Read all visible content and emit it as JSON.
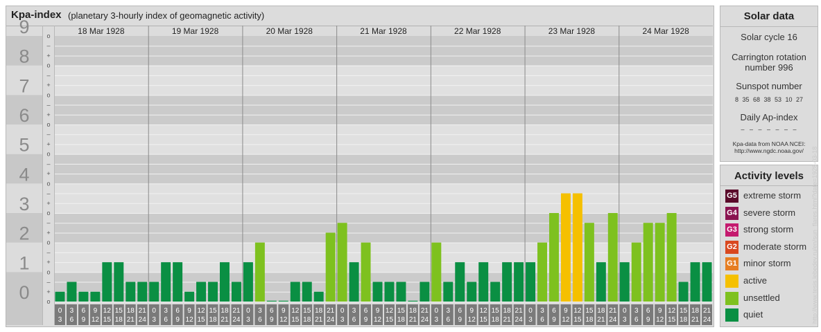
{
  "header": {
    "title": "Kpa-index",
    "subtitle": "(planetary 3-hourly index of geomagnetic activity)"
  },
  "chart_data": {
    "type": "bar",
    "title": "Kpa-index",
    "subtitle": "(planetary 3-hourly index of geomagnetic activity)",
    "ylim": [
      0,
      9
    ],
    "y_ticks": [
      "0",
      "1",
      "2",
      "3",
      "4",
      "5",
      "6",
      "7",
      "8",
      "9"
    ],
    "minor_tick_labels": [
      "+",
      "–",
      "o"
    ],
    "days": [
      "18 Mar 1928",
      "19 Mar 1928",
      "20 Mar 1928",
      "21 Mar 1928",
      "22 Mar 1928",
      "23 Mar 1928",
      "24 Mar 1928"
    ],
    "interval_labels": [
      [
        "0",
        "3"
      ],
      [
        "3",
        "6"
      ],
      [
        "6",
        "9"
      ],
      [
        "9",
        "12"
      ],
      [
        "12",
        "15"
      ],
      [
        "15",
        "18"
      ],
      [
        "18",
        "21"
      ],
      [
        "21",
        "24"
      ]
    ],
    "values": [
      [
        0.333,
        0.667,
        0.333,
        0.333,
        1.333,
        1.333,
        0.667,
        0.667
      ],
      [
        0.667,
        1.333,
        1.333,
        0.333,
        0.667,
        0.667,
        1.333,
        0.667
      ],
      [
        1.333,
        2.0,
        0.0,
        0.0,
        0.667,
        0.667,
        0.333,
        2.333
      ],
      [
        2.667,
        1.333,
        2.0,
        0.667,
        0.667,
        0.667,
        0.0,
        0.667
      ],
      [
        2.0,
        0.667,
        1.333,
        0.667,
        1.333,
        0.667,
        1.333,
        1.333
      ],
      [
        1.333,
        2.0,
        3.0,
        3.667,
        3.667,
        2.667,
        1.333,
        3.0
      ],
      [
        1.333,
        2.0,
        2.667,
        2.667,
        3.0,
        0.667,
        1.333,
        1.333
      ]
    ],
    "grid": true
  },
  "solar": {
    "title": "Solar data",
    "cycle": "Solar cycle 16",
    "carrington_line1": "Carrington rotation",
    "carrington_line2": "number 996",
    "sunspot_title": "Sunspot number",
    "sunspot_values": "8 35 68 38 53 10 27",
    "ap_title": "Daily Ap-index",
    "ap_values": "– – – – – – –",
    "source_line1": "Kpa-data from NOAA NCEI:",
    "source_line2": "http://www.ngdc.noaa.gov/"
  },
  "legend": {
    "title": "Activity levels",
    "items": [
      {
        "code": "G5",
        "label": "extreme storm",
        "color": "#5a0a2a"
      },
      {
        "code": "G4",
        "label": "severe storm",
        "color": "#8a1450"
      },
      {
        "code": "G3",
        "label": "strong storm",
        "color": "#c41a6e"
      },
      {
        "code": "G2",
        "label": "moderate storm",
        "color": "#d9481f"
      },
      {
        "code": "G1",
        "label": "minor storm",
        "color": "#e67e22"
      },
      {
        "code": "",
        "label": "active",
        "color": "#f5c000"
      },
      {
        "code": "",
        "label": "unsettled",
        "color": "#7ec11f"
      },
      {
        "code": "",
        "label": "quiet",
        "color": "#0a8f43"
      }
    ]
  },
  "watermark": "http://www.tesis.lebedev.ru/en/sun_flares.html?date=1928-03-18"
}
